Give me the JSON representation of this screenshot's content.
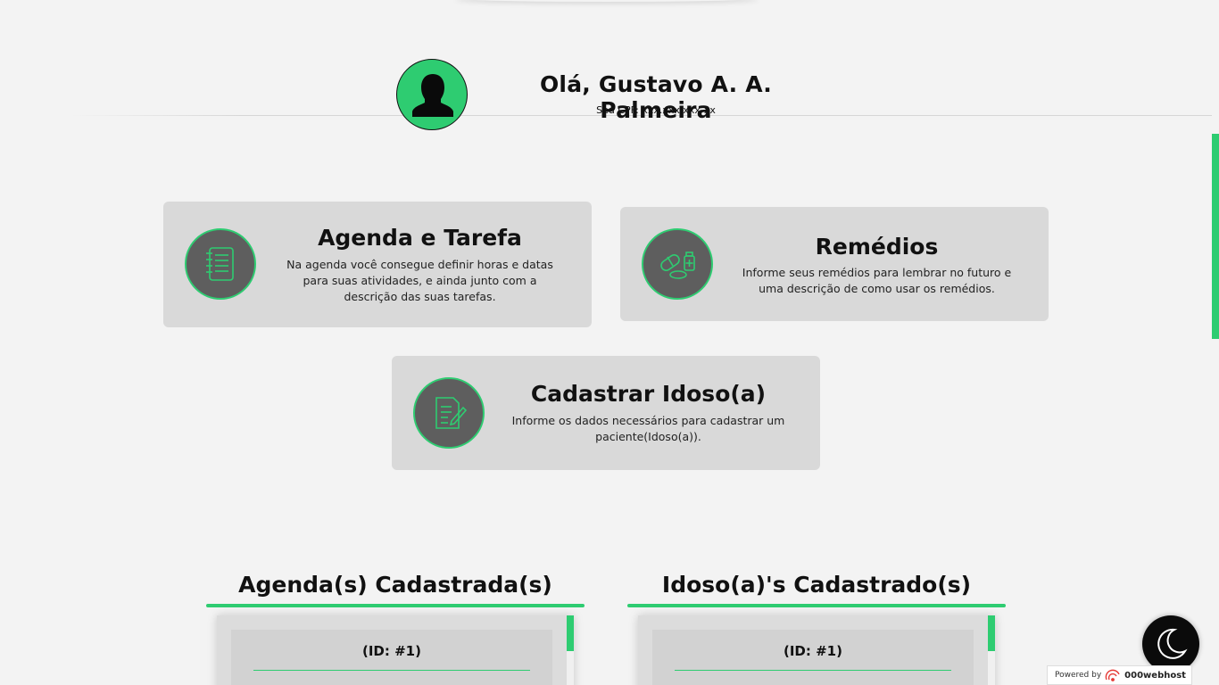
{
  "header": {
    "greeting": "Olá, Gustavo A. A. Palmeira",
    "cpf": "Seu CPF: xxx.xxx.xxx-xx",
    "avatar_icon": "user-silhouette-icon"
  },
  "cards": [
    {
      "title": "Agenda e Tarefa",
      "description": "Na agenda você consegue definir horas e datas para suas atividades, e ainda junto com a descrição das suas tarefas.",
      "icon": "notebook-icon"
    },
    {
      "title": "Remédios",
      "description": "Informe seus remédios para lembrar no futuro e uma descrição de como usar os remédios.",
      "icon": "pills-icon"
    },
    {
      "title": "Cadastrar Idoso(a)",
      "description": "Informe os dados necessários para cadastrar um paciente(Idoso(a)).",
      "icon": "form-edit-icon"
    }
  ],
  "sections": {
    "agendas": {
      "title": "Agenda(s) Cadastrada(s)",
      "first_item_id": "(ID: #1)"
    },
    "idosos": {
      "title": "Idoso(a)'s Cadastrado(s)",
      "first_item_id": "(ID: #1)"
    }
  },
  "footer": {
    "powered_by": "Powered by",
    "host_brand": "000webhost",
    "theme_toggle_icon": "moon-icon"
  },
  "colors": {
    "accent": "#2ecc71",
    "card_bg": "#d9d9d9",
    "page_bg": "#f3f3f3",
    "icon_bg": "#5e5e5e"
  }
}
